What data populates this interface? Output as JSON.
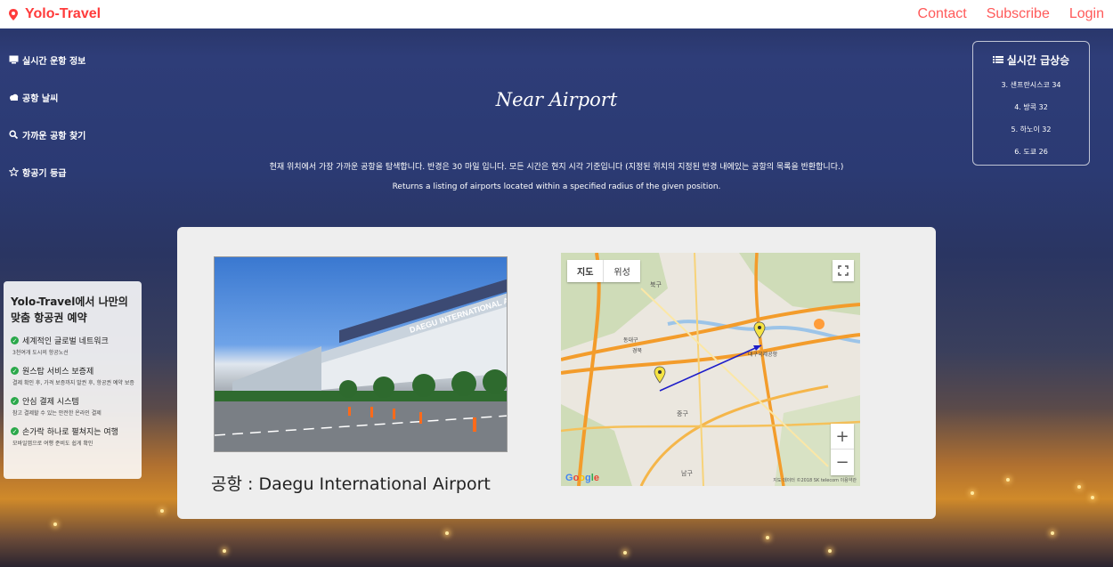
{
  "brand": {
    "name": "Yolo-Travel",
    "color": "#ff3b3b"
  },
  "nav": {
    "contact": "Contact",
    "subscribe": "Subscribe",
    "login": "Login"
  },
  "sidebar": {
    "items": [
      {
        "icon": "monitor-icon",
        "label": "실시간 운항 정보"
      },
      {
        "icon": "cloud-icon",
        "label": "공항 날씨"
      },
      {
        "icon": "search-icon",
        "label": "가까운 공항 찾기"
      },
      {
        "icon": "star-icon",
        "label": "항공기 등급"
      }
    ]
  },
  "hero": {
    "title": "Near Airport",
    "desc_ko": "현재 위치에서 가장 가까운 공항을 탐색합니다. 반경은 30 마일 입니다. 모든 시간은 현지 시각 기준입니다 (지정된 위치의 지정된 반경 내에있는 공항의 목록을 반환합니다.)",
    "desc_en": "Returns a listing of airports located within a specified radius of the given position."
  },
  "trending": {
    "title": "실시간 급상승",
    "icon": "list-icon",
    "items": [
      "3. 샌프란시스코 34",
      "4. 방콕 32",
      "5. 하노이 32",
      "6. 도쿄 26"
    ]
  },
  "booking": {
    "title": "Yolo-Travel에서 나만의 맞춤 항공권 예약",
    "features": [
      {
        "title": "세계적인 글로벌 네트워크",
        "desc": "3천여개 도시의 항공노선"
      },
      {
        "title": "원스탑 서비스 보증제",
        "desc": "결제 확인 후, 가격 보증까지 발권 후, 항공권 예약 보증"
      },
      {
        "title": "안심 결제 시스템",
        "desc": "참고 결제할 수 있는 안전한 온라인 결제"
      },
      {
        "title": "손가락 하나로 펼쳐지는 여행",
        "desc": "모바일앱으로 여행 준비도 쉽게 확인"
      }
    ]
  },
  "card": {
    "airport_label": "공항 : Daegu International Airport",
    "photo_sign": "DAEGU INTERNATIONAL AIRPORT"
  },
  "map": {
    "tab_map": "지도",
    "tab_satellite": "위성",
    "zoom_in": "+",
    "zoom_out": "−",
    "logo": "Google",
    "copyright": "지도 데이터 ©2018 SK telecom 이용약관",
    "district_north": "북구",
    "district_central": "중구",
    "district_south": "남구",
    "place_airport": "대구국제공항",
    "place_dongdaegu": "동대구",
    "place_gyeongbuk": "경북"
  }
}
